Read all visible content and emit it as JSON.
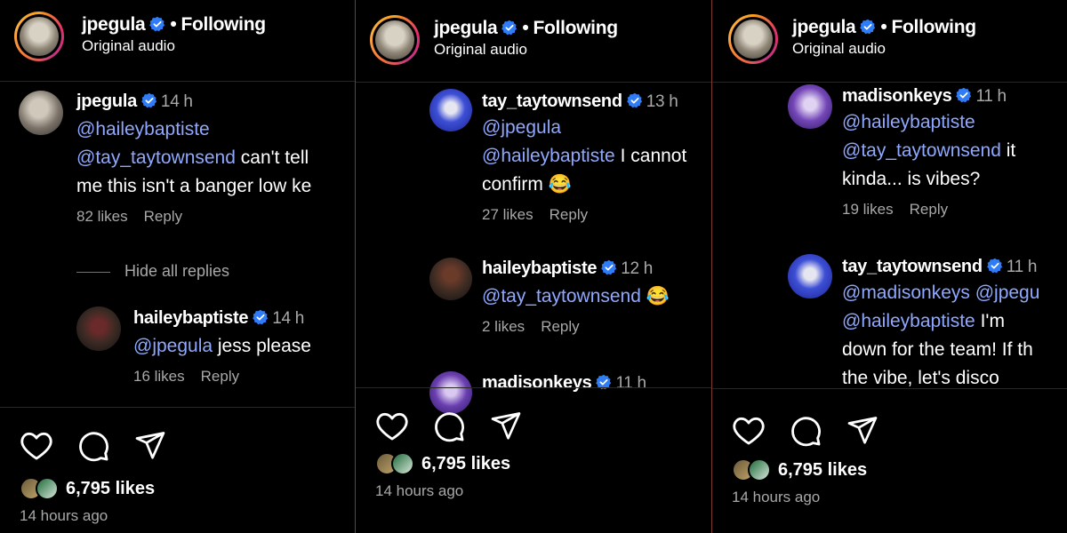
{
  "colors": {
    "mention": "#8fa8ff",
    "verified": "#2f7cf6",
    "separator": "#7a3b2e"
  },
  "panels": [
    {
      "header": {
        "username": "jpegula",
        "follow": "Following",
        "audio": "Original audio"
      },
      "comments": [
        {
          "user": "jpegula",
          "time": "14 h",
          "mentions": [
            "@haileybaptiste",
            "@tay_taytownsend"
          ],
          "text1": "can't tell",
          "text2": "me this isn't a banger low ke",
          "likes": "82 likes",
          "reply": "Reply"
        },
        {
          "user": "haileybaptiste",
          "time": "14 h",
          "mention": "@jpegula",
          "text": "jess please",
          "likes": "16 likes",
          "reply": "Reply"
        }
      ],
      "hide_replies": "Hide all replies",
      "footer": {
        "likes": "6,795 likes",
        "ago": "14 hours ago"
      }
    },
    {
      "header": {
        "username": "jpegula",
        "follow": "Following",
        "audio": "Original audio"
      },
      "comments": [
        {
          "user": "tay_taytownsend",
          "time": "13 h",
          "mentions": [
            "@jpegula",
            "@haileybaptiste"
          ],
          "text1": "I cannot",
          "text2": "confirm",
          "emoji": "😂",
          "likes": "27 likes",
          "reply": "Reply"
        },
        {
          "user": "haileybaptiste",
          "time": "12 h",
          "mention": "@tay_taytownsend",
          "emoji": "😂",
          "likes": "2 likes",
          "reply": "Reply"
        },
        {
          "user": "madisonkeys",
          "time": "11 h"
        }
      ],
      "footer": {
        "likes": "6,795 likes",
        "ago": "14 hours ago"
      }
    },
    {
      "header": {
        "username": "jpegula",
        "follow": "Following",
        "audio": "Original audio"
      },
      "comments": [
        {
          "user": "madisonkeys",
          "time": "11 h",
          "mentions": [
            "@haileybaptiste",
            "@tay_taytownsend"
          ],
          "text1": "it",
          "text2": "kinda... is vibes?",
          "likes": "19 likes",
          "reply": "Reply"
        },
        {
          "user": "tay_taytownsend",
          "time": "11 h",
          "mentions": [
            "@madisonkeys",
            "@jpegu",
            "@haileybaptiste"
          ],
          "text1": "I'm",
          "text2": "down for the team! If th",
          "text3": "the vibe, let's disco"
        }
      ],
      "footer": {
        "likes": "6,795 likes",
        "ago": "14 hours ago"
      }
    }
  ]
}
